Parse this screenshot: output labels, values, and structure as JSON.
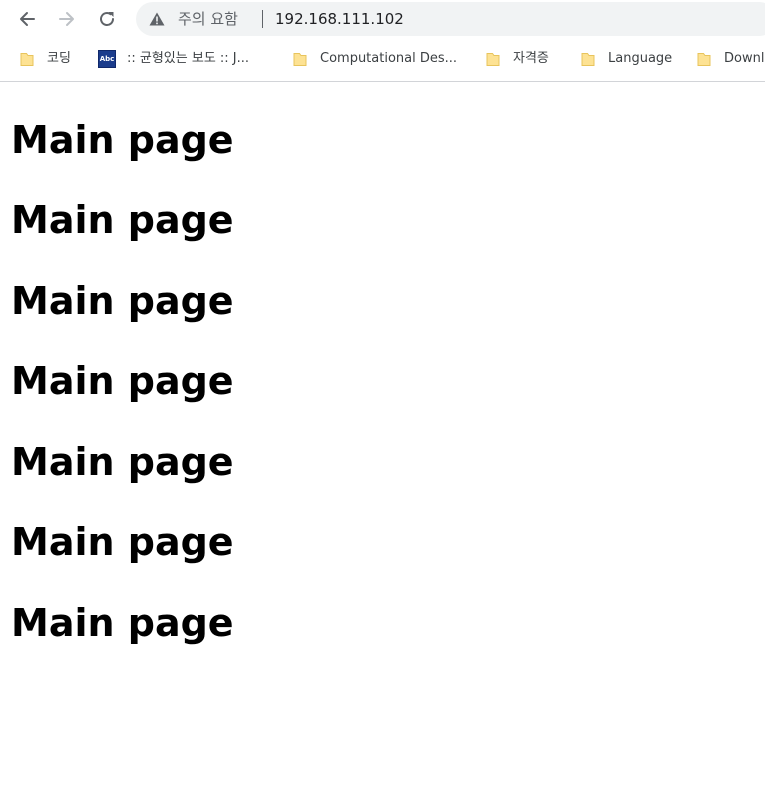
{
  "browser": {
    "security_label": "주의 요함",
    "url": "192.168.111.102",
    "bookmarks": [
      {
        "label": "코딩",
        "icon": "folder-icon"
      },
      {
        "label": ":: 균형있는 보도 :: J...",
        "icon": "site-favicon",
        "favicon_text": "Abc"
      },
      {
        "label": "Computational Des...",
        "icon": "folder-icon"
      },
      {
        "label": "자격증",
        "icon": "folder-icon"
      },
      {
        "label": "Language",
        "icon": "folder-icon"
      },
      {
        "label": "Downl",
        "icon": "folder-icon"
      }
    ]
  },
  "page": {
    "headings": [
      "Main page",
      "Main page",
      "Main page",
      "Main page",
      "Main page",
      "Main page",
      "Main page"
    ]
  },
  "colors": {
    "omnibox_bg": "#f1f3f4",
    "folder_fill": "#fde293",
    "folder_stroke": "#e8c45c",
    "favicon_bg": "#1b3c8c"
  }
}
